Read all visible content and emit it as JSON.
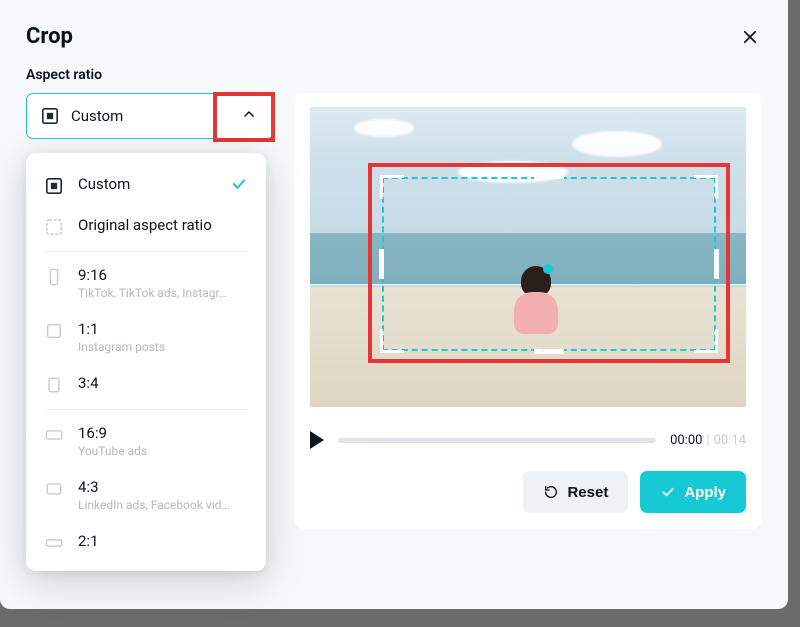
{
  "header": {
    "title": "Crop"
  },
  "aspect": {
    "label": "Aspect ratio",
    "selected": "Custom",
    "options": [
      {
        "icon": "custom",
        "label": "Custom",
        "sub": "",
        "selected": true
      },
      {
        "icon": "original",
        "label": "Original aspect ratio",
        "sub": ""
      },
      {
        "icon": "9:16",
        "label": "9:16",
        "sub": "TikTok, TikTok ads, Instagr…"
      },
      {
        "icon": "1:1",
        "label": "1:1",
        "sub": "Instagram posts"
      },
      {
        "icon": "3:4",
        "label": "3:4",
        "sub": ""
      },
      {
        "icon": "16:9",
        "label": "16:9",
        "sub": "YouTube ads"
      },
      {
        "icon": "4:3",
        "label": "4:3",
        "sub": "LinkedIn ads, Facebook vid…"
      },
      {
        "icon": "2:1",
        "label": "2:1",
        "sub": ""
      }
    ]
  },
  "video": {
    "current": "00:00",
    "duration": "00:14"
  },
  "buttons": {
    "reset": "Reset",
    "apply": "Apply"
  },
  "colors": {
    "accent": "#17c9d4",
    "highlight": "#e53535"
  }
}
